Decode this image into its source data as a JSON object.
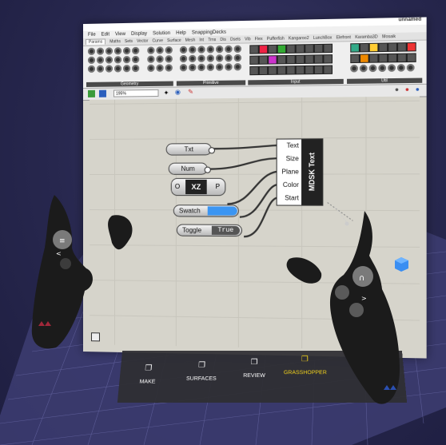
{
  "window": {
    "doc_title": "unnamed",
    "menu": [
      "File",
      "Edit",
      "View",
      "Display",
      "Solution",
      "Help",
      "SnappingDecks"
    ],
    "tabs": [
      "Params",
      "Maths",
      "Sets",
      "Vector",
      "Curve",
      "Surface",
      "Mesh",
      "Int",
      "Trns",
      "Dis",
      "Dsels",
      "Vib",
      "Flex",
      "Pufferfish",
      "Kangaroo2",
      "LunchBox",
      "Elefront",
      "Karamba3D",
      "Mosaik"
    ],
    "ribbon_groups": [
      "Geometry",
      "Primitive",
      "Input",
      "Util"
    ],
    "zoom": "195%"
  },
  "canvas": {
    "panel_txt": "Txt",
    "panel_num": "Num",
    "xz_input": "O",
    "xz_output": "P",
    "xz_label": "XZ",
    "swatch_label": "Swatch",
    "toggle_label": "Toggle",
    "toggle_value": "True",
    "mdsk_name": "MDSK Text",
    "mdsk_inputs": [
      "Text",
      "Size",
      "Plane",
      "Color",
      "Start"
    ],
    "swatch_color": "#3b95f2"
  },
  "bottom_menu": [
    {
      "label": "MAKE",
      "icon": "cube-outline-icon",
      "active": false
    },
    {
      "label": "SURFACES",
      "icon": "cube-outline-icon",
      "active": false
    },
    {
      "label": "REVIEW",
      "icon": "cube-outline-icon",
      "active": false
    },
    {
      "label": "GRASSHOPPER",
      "icon": "cube-outline-icon",
      "active": true
    }
  ],
  "colors": {
    "accent": "#f2d21b",
    "floor": "#3a3a6e",
    "controller": "#1b1b1b"
  }
}
